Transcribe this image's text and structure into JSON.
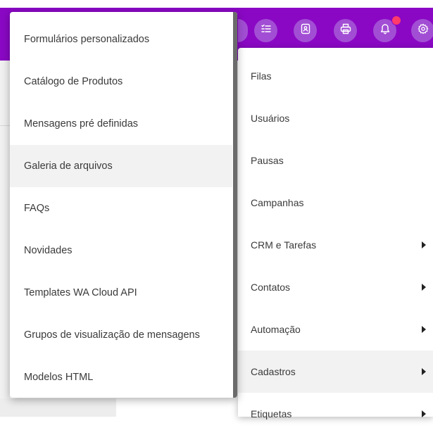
{
  "topbar": {
    "icons": [
      "checklist-icon",
      "contact-card-icon",
      "printer-icon",
      "bell-icon",
      "gear-icon"
    ],
    "notification_dot_color": "#ff3b6b",
    "bar_color": "#8a08c4"
  },
  "right_menu": {
    "items": [
      {
        "label": "Filas",
        "has_submenu": false
      },
      {
        "label": "Usuários",
        "has_submenu": false
      },
      {
        "label": "Pausas",
        "has_submenu": false
      },
      {
        "label": "Campanhas",
        "has_submenu": false
      },
      {
        "label": "CRM e Tarefas",
        "has_submenu": true
      },
      {
        "label": "Contatos",
        "has_submenu": true
      },
      {
        "label": "Automação",
        "has_submenu": true
      },
      {
        "label": "Cadastros",
        "has_submenu": true,
        "active": true
      },
      {
        "label": "Etiquetas",
        "has_submenu": true
      }
    ]
  },
  "submenu": {
    "items": [
      {
        "label": "Formulários personalizados"
      },
      {
        "label": "Catálogo de Produtos"
      },
      {
        "label": "Mensagens pré definidas"
      },
      {
        "label": "Galeria de arquivos",
        "active": true
      },
      {
        "label": "FAQs"
      },
      {
        "label": "Novidades"
      },
      {
        "label": "Templates WA Cloud API"
      },
      {
        "label": "Grupos de visualização de mensagens"
      },
      {
        "label": "Modelos HTML"
      }
    ]
  }
}
